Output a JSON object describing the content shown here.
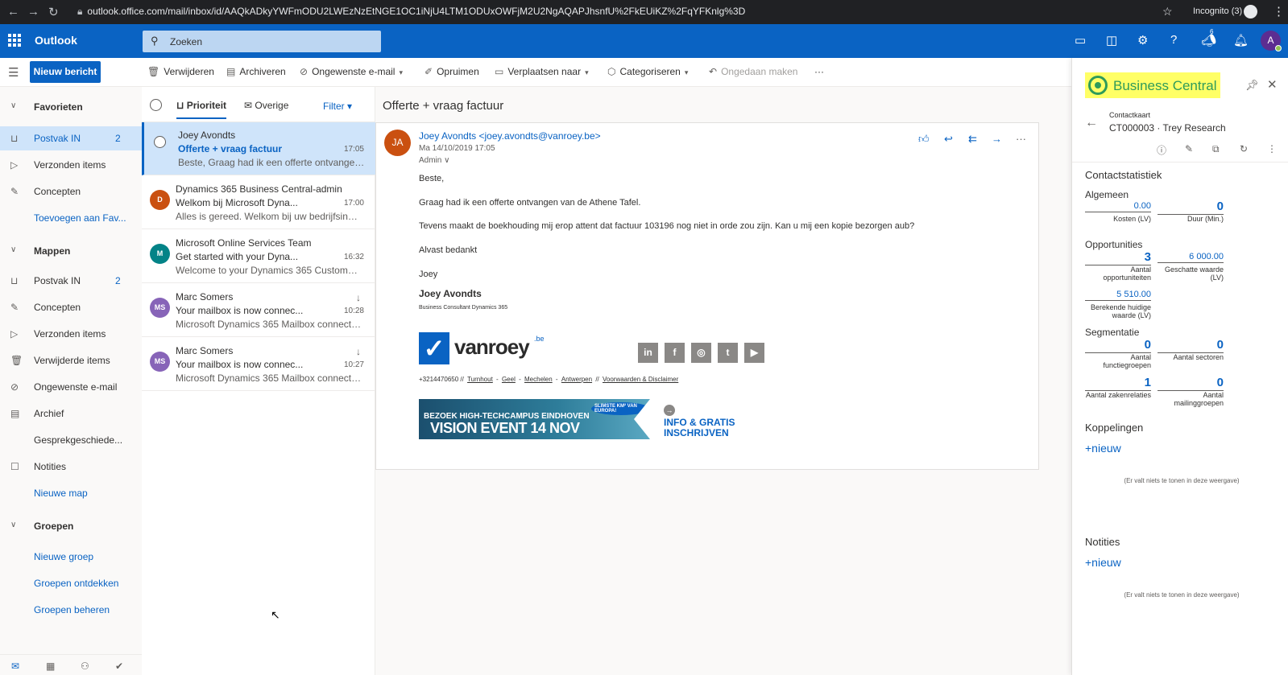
{
  "browser": {
    "url": "outlook.office.com/mail/inbox/id/AAQkADkyYWFmODU2LWEzNzEtNGE1OC1iNjU4LTM1ODUxOWFjM2U2NgAQAPJhsnfU%2FkEUiKZ%2FqYFKnlg%3D",
    "incognito_label": "Incognito (3)"
  },
  "suite": {
    "app_name": "Outlook",
    "search_placeholder": "Zoeken",
    "notification_badge": "6",
    "avatar_initial": "A"
  },
  "commands": {
    "new_message": "Nieuw bericht",
    "delete": "Verwijderen",
    "archive": "Archiveren",
    "junk": "Ongewenste e-mail",
    "sweep": "Opruimen",
    "move_to": "Verplaatsen naar",
    "categorize": "Categoriseren",
    "undo": "Ongedaan maken",
    "more": "···"
  },
  "nav": {
    "favorites_header": "Favorieten",
    "favorites": [
      {
        "label": "Postvak IN",
        "count": "2"
      },
      {
        "label": "Verzonden items",
        "count": ""
      },
      {
        "label": "Concepten",
        "count": ""
      }
    ],
    "add_favorite": "Toevoegen aan Fav...",
    "folders_header": "Mappen",
    "folders": [
      {
        "label": "Postvak IN",
        "count": "2"
      },
      {
        "label": "Concepten",
        "count": ""
      },
      {
        "label": "Verzonden items",
        "count": ""
      },
      {
        "label": "Verwijderde items",
        "count": ""
      },
      {
        "label": "Ongewenste e-mail",
        "count": ""
      },
      {
        "label": "Archief",
        "count": ""
      },
      {
        "label": "Gesprekgeschiede...",
        "count": ""
      },
      {
        "label": "Notities",
        "count": ""
      }
    ],
    "new_folder": "Nieuwe map",
    "groups_header": "Groepen",
    "new_group": "Nieuwe groep",
    "discover_groups": "Groepen ontdekken",
    "manage_groups": "Groepen beheren"
  },
  "list": {
    "tab_focused": "Prioriteit",
    "tab_other": "Overige",
    "filter": "Filter",
    "messages": [
      {
        "from": "Joey Avondts",
        "subject": "Offerte + vraag factuur",
        "preview": "Beste, Graag had ik een offerte ontvangen v...",
        "time": "17:05",
        "initials": "",
        "color": "",
        "selected": true
      },
      {
        "from": "Dynamics 365 Business Central-admin",
        "subject": "Welkom bij Microsoft Dyna...",
        "preview": "Alles is gereed. Welkom bij uw bedrijfsinbox...",
        "time": "17:00",
        "initials": "D",
        "color": "#ca5010",
        "selected": false
      },
      {
        "from": "Microsoft Online Services Team",
        "subject": "Get started with your Dyna...",
        "preview": "Welcome to your Dynamics 365 Customer E...",
        "time": "16:32",
        "initials": "M",
        "color": "#038387",
        "selected": false
      },
      {
        "from": "Marc Somers",
        "subject": "Your mailbox is now connec...",
        "preview": "Microsoft Dynamics 365 Mailbox connected...",
        "time": "10:28",
        "initials": "MS",
        "color": "#8764b8",
        "selected": false
      },
      {
        "from": "Marc Somers",
        "subject": "Your mailbox is now connec...",
        "preview": "Microsoft Dynamics 365 Mailbox connected...",
        "time": "10:27",
        "initials": "MS",
        "color": "#8764b8",
        "selected": false
      }
    ]
  },
  "mail": {
    "subject": "Offerte + vraag factuur",
    "sender_initials": "JA",
    "sender": "Joey Avondts <joey.avondts@vanroey.be>",
    "date": "Ma 14/10/2019 17:05",
    "to": "Admin",
    "body": [
      "Beste,",
      "Graag had ik een offerte ontvangen van de Athene Tafel.",
      "Tevens maakt de boekhouding mij erop attent dat factuur 103196 nog niet in orde zou zijn. Kan u mij een kopie bezorgen aub?",
      "Alvast bedankt",
      "Joey"
    ],
    "sig_name": "Joey Avondts",
    "sig_title": "Business Consultant Dynamics 365",
    "logo_text": "vanroey",
    "logo_tld": ".be",
    "social": [
      "in",
      "f",
      "◎",
      "t",
      "▶"
    ],
    "phone": "+3214470650 //",
    "links": [
      "Turnhout",
      "-",
      "Geel",
      "-",
      "Mechelen",
      "-",
      "Antwerpen",
      "//",
      "Voorwaarden & Disclaimer"
    ],
    "banner_line1": "BEZOEK HIGH-TECHCAMPUS EINDHOVEN",
    "banner_line2": "VISION EVENT 14 NOV",
    "banner_badge": "SLIMSTE KM² VAN EUROPA!",
    "cta_line1": "INFO & GRATIS",
    "cta_line2": "INSCHRIJVEN"
  },
  "bc": {
    "title": "Business Central",
    "card_type": "Contactkaart",
    "card_name": "CT000003 · Trey Research",
    "stats_header": "Contactstatistiek",
    "general_header": "Algemeen",
    "cost_value": "0.00",
    "cost_label": "Kosten (LV)",
    "duration_value": "0",
    "duration_label": "Duur (Min.)",
    "opp_header": "Opportunities",
    "opp_count": "3",
    "opp_count_label": "Aantal opportuniteiten",
    "opp_est_value": "6 000.00",
    "opp_est_label": "Geschatte waarde (LV)",
    "opp_calc_value": "5 510.00",
    "opp_calc_label": "Berekende huidige waarde (LV)",
    "seg_header": "Segmentatie",
    "func_groups_value": "0",
    "func_groups_label": "Aantal functiegroepen",
    "sectors_value": "0",
    "sectors_label": "Aantal sectoren",
    "biz_rel_value": "1",
    "biz_rel_label": "Aantal zakenrelaties",
    "mail_groups_value": "0",
    "mail_groups_label": "Aantal mailinggroepen",
    "links_header": "Koppelingen",
    "new_label": "+nieuw",
    "empty_text": "(Er valt niets te tonen in deze weergave)",
    "notes_header": "Notities"
  }
}
